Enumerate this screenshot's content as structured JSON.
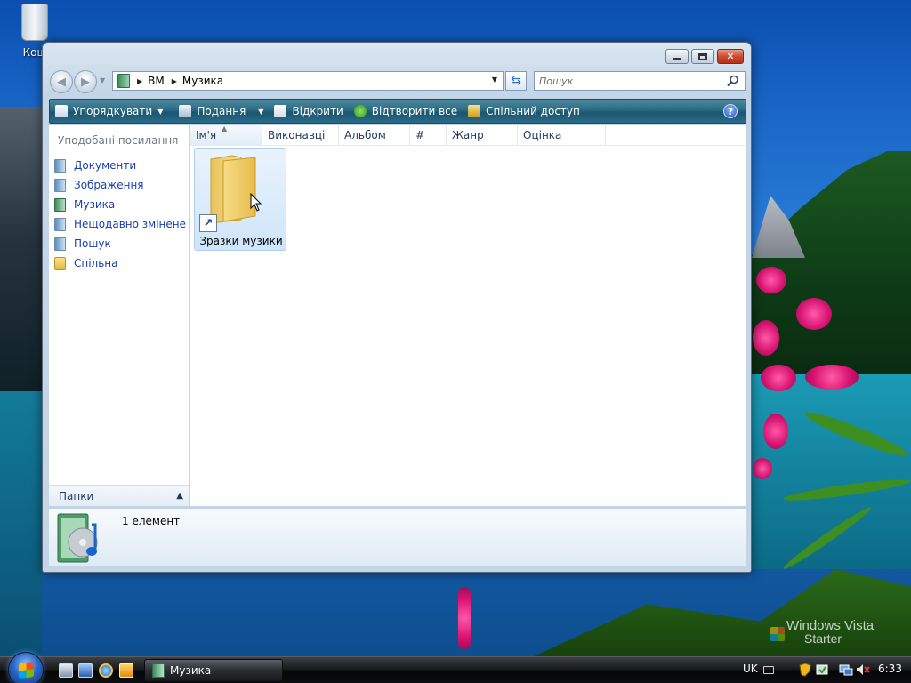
{
  "desktop": {
    "recycle_bin_label": "Кош",
    "watermark_line1": "Windows Vista",
    "watermark_line2": "Starter"
  },
  "window": {
    "address": {
      "segments": [
        "ВМ",
        "Музика"
      ]
    },
    "search": {
      "placeholder": "Пошук"
    },
    "command_bar": {
      "organize": "Упорядкувати",
      "views": "Подання",
      "open": "Відкрити",
      "play_all": "Відтворити все",
      "share": "Спільний доступ",
      "help": "?"
    },
    "nav_pane": {
      "title": "Уподобані посилання",
      "items": [
        {
          "label": "Документи",
          "icon": "documents-icon"
        },
        {
          "label": "Зображення",
          "icon": "pictures-icon"
        },
        {
          "label": "Музика",
          "icon": "music-icon"
        },
        {
          "label": "Нещодавно змінене",
          "icon": "recent-icon"
        },
        {
          "label": "Пошук",
          "icon": "searches-icon"
        },
        {
          "label": "Спільна",
          "icon": "public-folder-icon"
        }
      ],
      "folders_label": "Папки"
    },
    "columns": [
      "Ім'я",
      "Виконавці",
      "Альбом",
      "#",
      "Жанр",
      "Оцінка"
    ],
    "files": [
      {
        "name": "Зразки музики",
        "icon": "folder-shortcut-icon"
      }
    ],
    "details": {
      "count": "1 елемент"
    }
  },
  "taskbar": {
    "task_label": "Музика",
    "language": "UK",
    "clock": "6:33"
  },
  "colors": {
    "command_bar": "#2b6a84",
    "link_blue": "#1a3fae",
    "taskbar": "#16181a",
    "close_button": "#cc4a32"
  }
}
